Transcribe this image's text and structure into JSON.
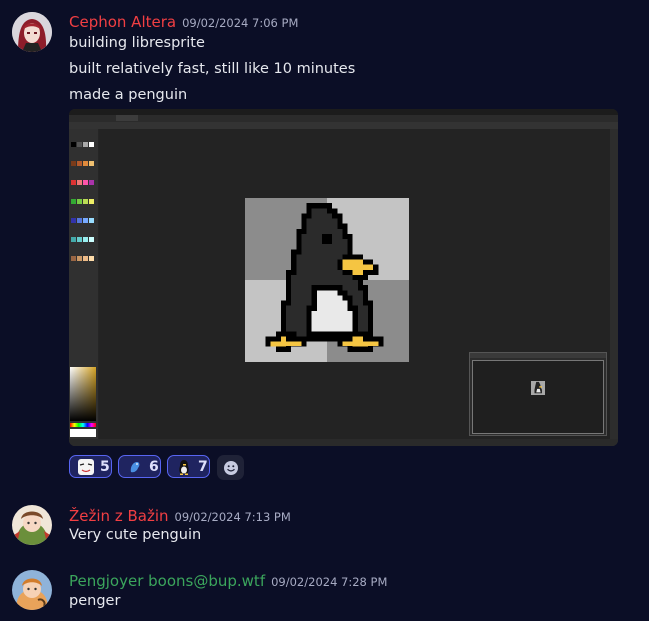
{
  "messages": [
    {
      "author": "Cephon Altera",
      "author_color": "#f23f43",
      "timestamp": "09/02/2024 7:06 PM",
      "lines": [
        "building libresprite",
        "built relatively fast, still like 10 minutes",
        "made a penguin"
      ],
      "avatar_icon": "red-haired-character-avatar",
      "attachment": {
        "type": "screenshot",
        "app": "LibreSprite",
        "description_icon": "pixel-penguin-sprite"
      },
      "reactions": [
        {
          "icon": "anime-face-emoji",
          "count": "5"
        },
        {
          "icon": "blue-bird-emoji",
          "count": "6"
        },
        {
          "icon": "penguin-emoji",
          "count": "7"
        }
      ],
      "add_reaction_icon": "smiley-add-reaction-icon"
    },
    {
      "author": "Žežin z Bažin",
      "author_color": "#f23f43",
      "timestamp": "09/02/2024 7:13 PM",
      "lines": [
        "Very cute penguin"
      ],
      "avatar_icon": "illustrated-character-avatar"
    },
    {
      "author": "Pengjoyer boons@bup.wtf",
      "author_color": "#3ba55c",
      "timestamp": "09/02/2024 7:28 PM",
      "lines": [
        "penger"
      ],
      "avatar_icon": "orange-character-avatar"
    }
  ],
  "colors": {
    "background": "#0b0e26",
    "reaction_bg": "#1f2460",
    "reaction_border": "#5865f2",
    "penguin_beak": "#f5c542"
  }
}
